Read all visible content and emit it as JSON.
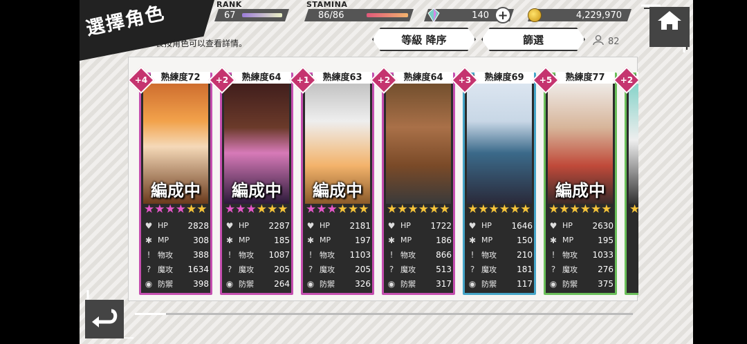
{
  "header": {
    "title": "選擇角色",
    "hint": "長按角色可以查看詳情。",
    "rank_label": "RANK",
    "rank_value": "67",
    "stamina_label": "STAMINA",
    "stamina_value": "86/86",
    "gems": "140",
    "gold": "4,229,970",
    "sort_label": "等級 降序",
    "filter_label": "篩選",
    "character_count": "82"
  },
  "colors": {
    "pink_border": "#c54fb0",
    "green_border": "#6bbf5a",
    "blue_border": "#46a5c8",
    "gold_star": "#f6c43a",
    "pink_star": "#e657c9"
  },
  "stat_labels": {
    "hp": "HP",
    "mp": "MP",
    "patk": "物攻",
    "matk": "魔攻",
    "def": "防禦"
  },
  "cards": [
    {
      "plus": "+4",
      "prof": "熟練度72",
      "formation": "編成中",
      "pink_stars": 4,
      "gold_stars": 2,
      "hp": "2828",
      "mp": "308",
      "patk": "388",
      "matk": "1634",
      "def": "398"
    },
    {
      "plus": "+2",
      "prof": "熟練度64",
      "formation": "編成中",
      "pink_stars": 3,
      "gold_stars": 3,
      "hp": "2287",
      "mp": "185",
      "patk": "1087",
      "matk": "205",
      "def": "264"
    },
    {
      "plus": "+1",
      "prof": "熟練度63",
      "formation": "編成中",
      "pink_stars": 3,
      "gold_stars": 3,
      "hp": "2181",
      "mp": "197",
      "patk": "1103",
      "matk": "205",
      "def": "326"
    },
    {
      "plus": "+2",
      "prof": "熟練度64",
      "formation": "",
      "pink_stars": 0,
      "gold_stars": 6,
      "hp": "1722",
      "mp": "186",
      "patk": "866",
      "matk": "513",
      "def": "317"
    },
    {
      "plus": "+3",
      "prof": "熟練度69",
      "formation": "",
      "pink_stars": 0,
      "gold_stars": 6,
      "hp": "1646",
      "mp": "150",
      "patk": "210",
      "matk": "181",
      "def": "117"
    },
    {
      "plus": "+5",
      "prof": "熟練度77",
      "formation": "編成中",
      "pink_stars": 0,
      "gold_stars": 6,
      "hp": "2630",
      "mp": "195",
      "patk": "1033",
      "matk": "276",
      "def": "375"
    },
    {
      "plus": "+2",
      "prof": "",
      "formation": "",
      "pink_stars": 0,
      "gold_stars": 1,
      "hp": "",
      "mp": "",
      "patk": "",
      "matk": "",
      "def": ""
    }
  ]
}
